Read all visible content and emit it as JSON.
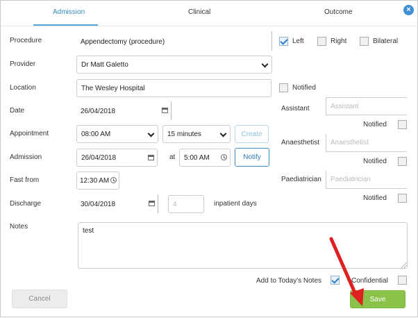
{
  "tabs": [
    {
      "label": "Admission",
      "active": true
    },
    {
      "label": "Clinical",
      "active": false
    },
    {
      "label": "Outcome",
      "active": false
    }
  ],
  "close_icon": "close-icon",
  "form": {
    "procedure": {
      "label": "Procedure",
      "value": "Appendectomy (procedure)"
    },
    "laterality": {
      "left": "Left",
      "right": "Right",
      "bilateral": "Bilateral",
      "left_checked": true,
      "right_checked": false,
      "bilateral_checked": false
    },
    "provider": {
      "label": "Provider",
      "value": "Dr Matt Galetto"
    },
    "location": {
      "label": "Location",
      "value": "The Wesley Hospital",
      "notified_label": "Notified",
      "notified_checked": false
    },
    "date": {
      "label": "Date",
      "value": "26/04/2018"
    },
    "appointment": {
      "label": "Appointment",
      "time": "08:00 AM",
      "duration": "15 minutes",
      "create_label": "Create"
    },
    "admission": {
      "label": "Admission",
      "date": "26/04/2018",
      "at_label": "at",
      "time": "5:00 AM",
      "notify_label": "Notify"
    },
    "fast_from": {
      "label": "Fast from",
      "time": "12:30 AM"
    },
    "discharge": {
      "label": "Discharge",
      "date": "30/04/2018",
      "days": "4",
      "days_label": "inpatient days"
    },
    "notes": {
      "label": "Notes",
      "value": "test"
    },
    "assistant": {
      "label": "Assistant",
      "placeholder": "Assistant",
      "notified_label": "Notified",
      "notified_checked": false
    },
    "anaesthetist": {
      "label": "Anaesthetist",
      "placeholder": "Anaesthetist",
      "notified_label": "Notified",
      "notified_checked": false
    },
    "paediatrician": {
      "label": "Paediatrician",
      "placeholder": "Paediatrician",
      "notified_label": "Notified",
      "notified_checked": false
    },
    "add_to_notes": {
      "label": "Add to Today's Notes",
      "checked": true
    },
    "confidential": {
      "label": "Confidential",
      "checked": false
    }
  },
  "footer": {
    "cancel_label": "Cancel",
    "save_label": "Save"
  },
  "colors": {
    "accent": "#3a8cbd",
    "save_green": "#8bc34a",
    "annotation_arrow": "#e02020"
  }
}
